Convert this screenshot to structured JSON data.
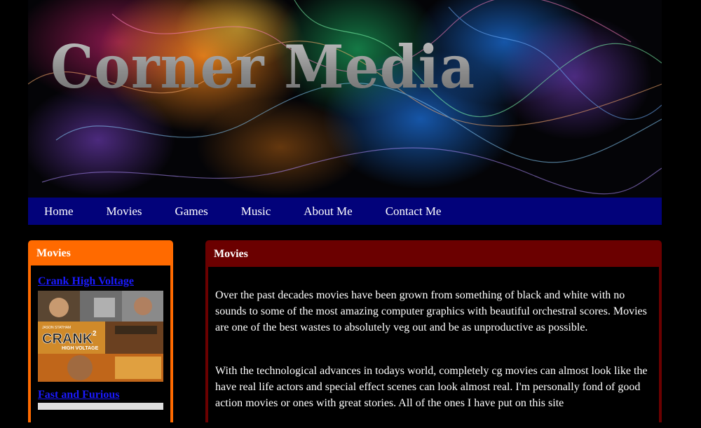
{
  "banner": {
    "title": "Corner Media"
  },
  "nav": {
    "items": [
      "Home",
      "Movies",
      "Games",
      "Music",
      "About Me",
      "Contact Me"
    ]
  },
  "sidebar": {
    "title": "Movies",
    "links": [
      "Crank High Voltage",
      "Fast and Furious"
    ],
    "poster": {
      "title": "CRANK",
      "sequel_mark": "2",
      "subtitle": "HIGH VOLTAGE",
      "credits": "JASON STATHAM"
    }
  },
  "content": {
    "title": "Movies",
    "paragraphs": [
      "Over the past decades movies have been grown from something of black and white with no sounds to some of the most amazing computer graphics with beautiful orchestral scores. Movies are one of the best wastes to absolutely veg out and be as unproductive as possible.",
      "With the technological advances in todays world, completely cg movies can almost look like the have real life actors and special effect scenes can look almost real. I'm personally fond of good action movies or ones with great stories. All of the ones I have put on this site"
    ]
  },
  "colors": {
    "nav_bg": "#02027a",
    "sidebar_accent": "#ff6a00",
    "content_accent": "#6b0000",
    "link": "#1a1aff"
  }
}
